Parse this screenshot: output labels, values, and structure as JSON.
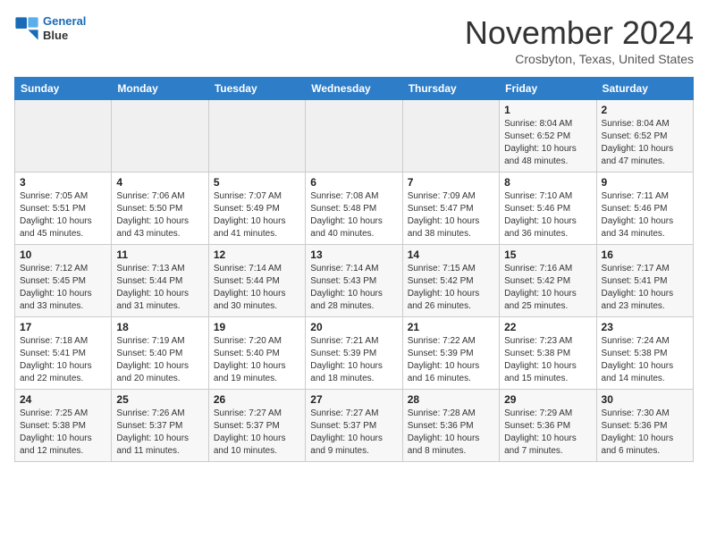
{
  "header": {
    "logo_line1": "General",
    "logo_line2": "Blue",
    "month": "November 2024",
    "location": "Crosbyton, Texas, United States"
  },
  "weekdays": [
    "Sunday",
    "Monday",
    "Tuesday",
    "Wednesday",
    "Thursday",
    "Friday",
    "Saturday"
  ],
  "weeks": [
    [
      {
        "day": "",
        "info": ""
      },
      {
        "day": "",
        "info": ""
      },
      {
        "day": "",
        "info": ""
      },
      {
        "day": "",
        "info": ""
      },
      {
        "day": "",
        "info": ""
      },
      {
        "day": "1",
        "info": "Sunrise: 8:04 AM\nSunset: 6:52 PM\nDaylight: 10 hours\nand 48 minutes."
      },
      {
        "day": "2",
        "info": "Sunrise: 8:04 AM\nSunset: 6:52 PM\nDaylight: 10 hours\nand 47 minutes."
      }
    ],
    [
      {
        "day": "3",
        "info": "Sunrise: 7:05 AM\nSunset: 5:51 PM\nDaylight: 10 hours\nand 45 minutes."
      },
      {
        "day": "4",
        "info": "Sunrise: 7:06 AM\nSunset: 5:50 PM\nDaylight: 10 hours\nand 43 minutes."
      },
      {
        "day": "5",
        "info": "Sunrise: 7:07 AM\nSunset: 5:49 PM\nDaylight: 10 hours\nand 41 minutes."
      },
      {
        "day": "6",
        "info": "Sunrise: 7:08 AM\nSunset: 5:48 PM\nDaylight: 10 hours\nand 40 minutes."
      },
      {
        "day": "7",
        "info": "Sunrise: 7:09 AM\nSunset: 5:47 PM\nDaylight: 10 hours\nand 38 minutes."
      },
      {
        "day": "8",
        "info": "Sunrise: 7:10 AM\nSunset: 5:46 PM\nDaylight: 10 hours\nand 36 minutes."
      },
      {
        "day": "9",
        "info": "Sunrise: 7:11 AM\nSunset: 5:46 PM\nDaylight: 10 hours\nand 34 minutes."
      }
    ],
    [
      {
        "day": "10",
        "info": "Sunrise: 7:12 AM\nSunset: 5:45 PM\nDaylight: 10 hours\nand 33 minutes."
      },
      {
        "day": "11",
        "info": "Sunrise: 7:13 AM\nSunset: 5:44 PM\nDaylight: 10 hours\nand 31 minutes."
      },
      {
        "day": "12",
        "info": "Sunrise: 7:14 AM\nSunset: 5:44 PM\nDaylight: 10 hours\nand 30 minutes."
      },
      {
        "day": "13",
        "info": "Sunrise: 7:14 AM\nSunset: 5:43 PM\nDaylight: 10 hours\nand 28 minutes."
      },
      {
        "day": "14",
        "info": "Sunrise: 7:15 AM\nSunset: 5:42 PM\nDaylight: 10 hours\nand 26 minutes."
      },
      {
        "day": "15",
        "info": "Sunrise: 7:16 AM\nSunset: 5:42 PM\nDaylight: 10 hours\nand 25 minutes."
      },
      {
        "day": "16",
        "info": "Sunrise: 7:17 AM\nSunset: 5:41 PM\nDaylight: 10 hours\nand 23 minutes."
      }
    ],
    [
      {
        "day": "17",
        "info": "Sunrise: 7:18 AM\nSunset: 5:41 PM\nDaylight: 10 hours\nand 22 minutes."
      },
      {
        "day": "18",
        "info": "Sunrise: 7:19 AM\nSunset: 5:40 PM\nDaylight: 10 hours\nand 20 minutes."
      },
      {
        "day": "19",
        "info": "Sunrise: 7:20 AM\nSunset: 5:40 PM\nDaylight: 10 hours\nand 19 minutes."
      },
      {
        "day": "20",
        "info": "Sunrise: 7:21 AM\nSunset: 5:39 PM\nDaylight: 10 hours\nand 18 minutes."
      },
      {
        "day": "21",
        "info": "Sunrise: 7:22 AM\nSunset: 5:39 PM\nDaylight: 10 hours\nand 16 minutes."
      },
      {
        "day": "22",
        "info": "Sunrise: 7:23 AM\nSunset: 5:38 PM\nDaylight: 10 hours\nand 15 minutes."
      },
      {
        "day": "23",
        "info": "Sunrise: 7:24 AM\nSunset: 5:38 PM\nDaylight: 10 hours\nand 14 minutes."
      }
    ],
    [
      {
        "day": "24",
        "info": "Sunrise: 7:25 AM\nSunset: 5:38 PM\nDaylight: 10 hours\nand 12 minutes."
      },
      {
        "day": "25",
        "info": "Sunrise: 7:26 AM\nSunset: 5:37 PM\nDaylight: 10 hours\nand 11 minutes."
      },
      {
        "day": "26",
        "info": "Sunrise: 7:27 AM\nSunset: 5:37 PM\nDaylight: 10 hours\nand 10 minutes."
      },
      {
        "day": "27",
        "info": "Sunrise: 7:27 AM\nSunset: 5:37 PM\nDaylight: 10 hours\nand 9 minutes."
      },
      {
        "day": "28",
        "info": "Sunrise: 7:28 AM\nSunset: 5:36 PM\nDaylight: 10 hours\nand 8 minutes."
      },
      {
        "day": "29",
        "info": "Sunrise: 7:29 AM\nSunset: 5:36 PM\nDaylight: 10 hours\nand 7 minutes."
      },
      {
        "day": "30",
        "info": "Sunrise: 7:30 AM\nSunset: 5:36 PM\nDaylight: 10 hours\nand 6 minutes."
      }
    ]
  ]
}
